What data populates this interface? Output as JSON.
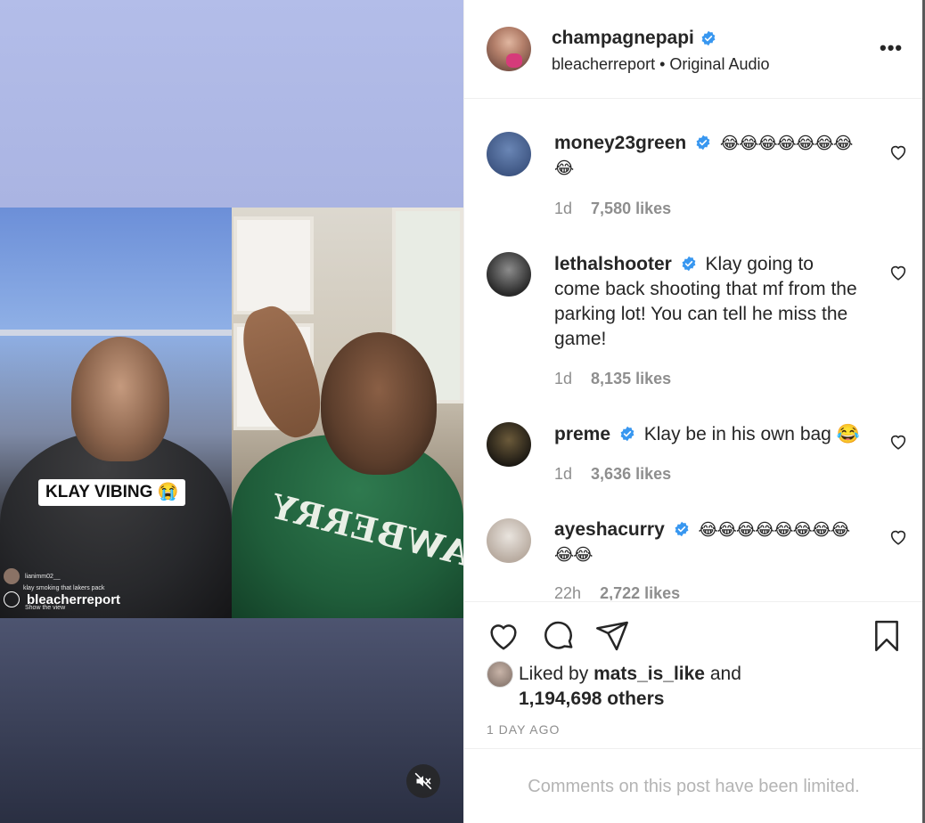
{
  "media": {
    "caption_label": "KLAY VIBING 😭",
    "live_comment_user": "lianimm02__",
    "live_comment_text": "klay smoking that lakers pack",
    "watermark": "bleacherreport",
    "watermark_sub": "Show the view",
    "hoodie_text": "STRAWBERRY",
    "mute_icon": "speaker-muted-icon"
  },
  "post": {
    "owner": "champagnepapi",
    "audio_source": "bleacherreport",
    "audio_separator": "•",
    "audio_label": "Original Audio",
    "more_label": "•••"
  },
  "comments": [
    {
      "user": "money23green",
      "text": "😂😂😂😂😂😂😂😂",
      "age": "1d",
      "likes": "7,580 likes"
    },
    {
      "user": "lethalshooter",
      "text": "Klay going to come back shooting that mf from the parking lot! You can tell he miss the game!",
      "age": "1d",
      "likes": "8,135 likes"
    },
    {
      "user": "preme",
      "text": "Klay be in his own bag 😂",
      "age": "1d",
      "likes": "3,636 likes"
    },
    {
      "user": "ayeshacurry",
      "text": "😂😂😂😂😂😂😂😂😂😂",
      "age": "22h",
      "likes": "2,722 likes"
    }
  ],
  "likes": {
    "prefix": "Liked by",
    "user": "mats_is_like",
    "conjunction": "and",
    "others": "1,194,698 others"
  },
  "timestamp": "1 DAY AGO",
  "comments_limited": "Comments on this post have been limited.",
  "colors": {
    "verified": "#3897f0",
    "text": "#262626",
    "muted": "#8e8e8e",
    "border": "#efefef"
  }
}
